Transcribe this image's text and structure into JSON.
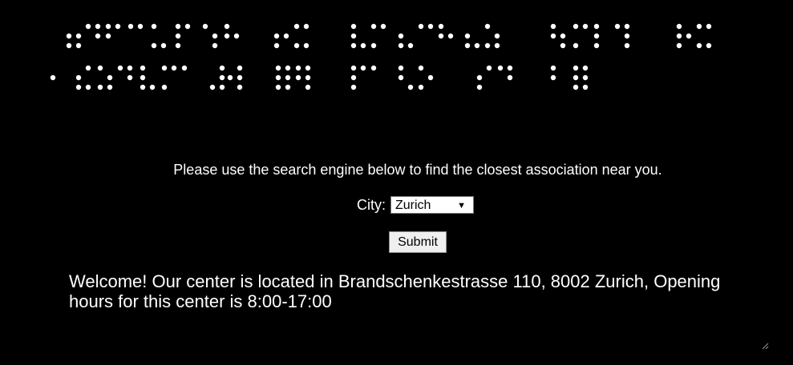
{
  "page": {
    "background_color": "#000000",
    "text_color": "#ffffff"
  },
  "braille_banner": {
    "description_icon": "braille-text-icon",
    "dot_color": "#ffffff"
  },
  "prompt_text": "Please use the search engine below to find the closest association near you.",
  "city_field": {
    "label": "City:",
    "selected_value": "Zurich",
    "caret_icon": "dropdown-caret-icon"
  },
  "submit_button": {
    "label": "Submit"
  },
  "welcome_message": "Welcome! Our center is located in Brandschenkestrasse 110, 8002 Zurich, Opening hours for this center is 8:00-17:00",
  "resize_grip_icon": "resize-grip-icon"
}
